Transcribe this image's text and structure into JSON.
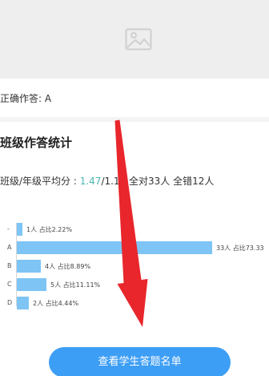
{
  "question": {
    "correct_answer_text": "正确作答: A"
  },
  "stats": {
    "title": "班级作答统计",
    "avg_prefix": "班级/年级平均分 : ",
    "class_avg": "1.47",
    "avg_suffix": "/1.18 全对33人 全错12人"
  },
  "chart_data": {
    "type": "bar",
    "orientation": "horizontal",
    "categories": [
      "-",
      "A",
      "B",
      "C",
      "D"
    ],
    "values": [
      1,
      33,
      4,
      5,
      2
    ],
    "labels": [
      "1人 占比2.22%",
      "33人 占比73.33",
      "4人 占比8.89%",
      "5人 占比11.11%",
      "2人 占比4.44%"
    ],
    "bar_color": "#7ec4f5"
  },
  "footer": {
    "student_list_button": "查看学生答题名单"
  },
  "colors": {
    "accent": "#3d9ef5",
    "teal": "#4ab6b0",
    "annotation_arrow": "#e8262b"
  }
}
